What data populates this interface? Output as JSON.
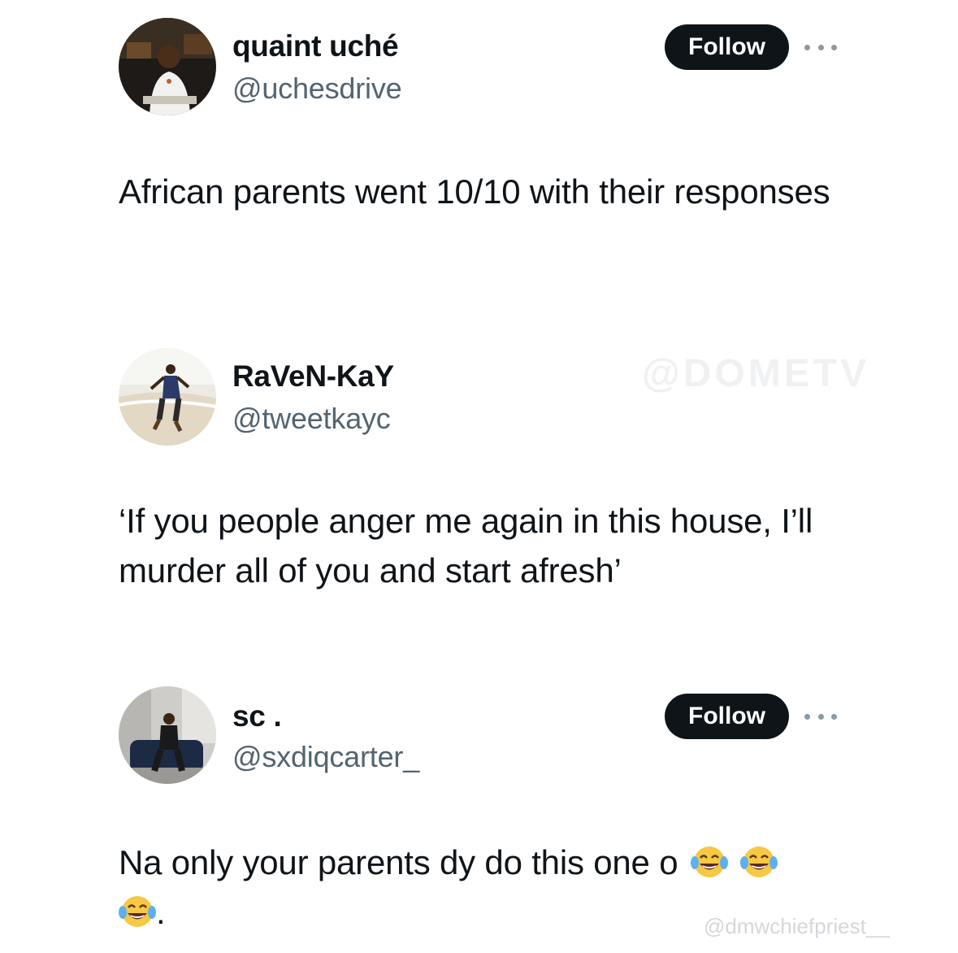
{
  "watermarks": {
    "top": "@DOMETV",
    "bottom": "@dmwchiefpriest__"
  },
  "tweets": [
    {
      "name": "quaint uché",
      "handle": "@uchesdrive",
      "follow_label": "Follow",
      "text": "African parents went 10/10 with their responses"
    },
    {
      "name": "RaVeN-KaY",
      "handle": "@tweetkayc",
      "text": "‘If you people anger me again in this house, I’ll murder all of you and start afresh’"
    },
    {
      "name": "sc .",
      "handle": "@sxdiqcarter_",
      "follow_label": "Follow",
      "text": "Na only your parents dy do this one o",
      "text_suffix": "."
    }
  ],
  "icons": [
    "more-icon",
    "laughing-crying-emoji"
  ],
  "colors": {
    "follow_button": "#0f1419",
    "handle": "#536471",
    "text": "#0f1419"
  }
}
